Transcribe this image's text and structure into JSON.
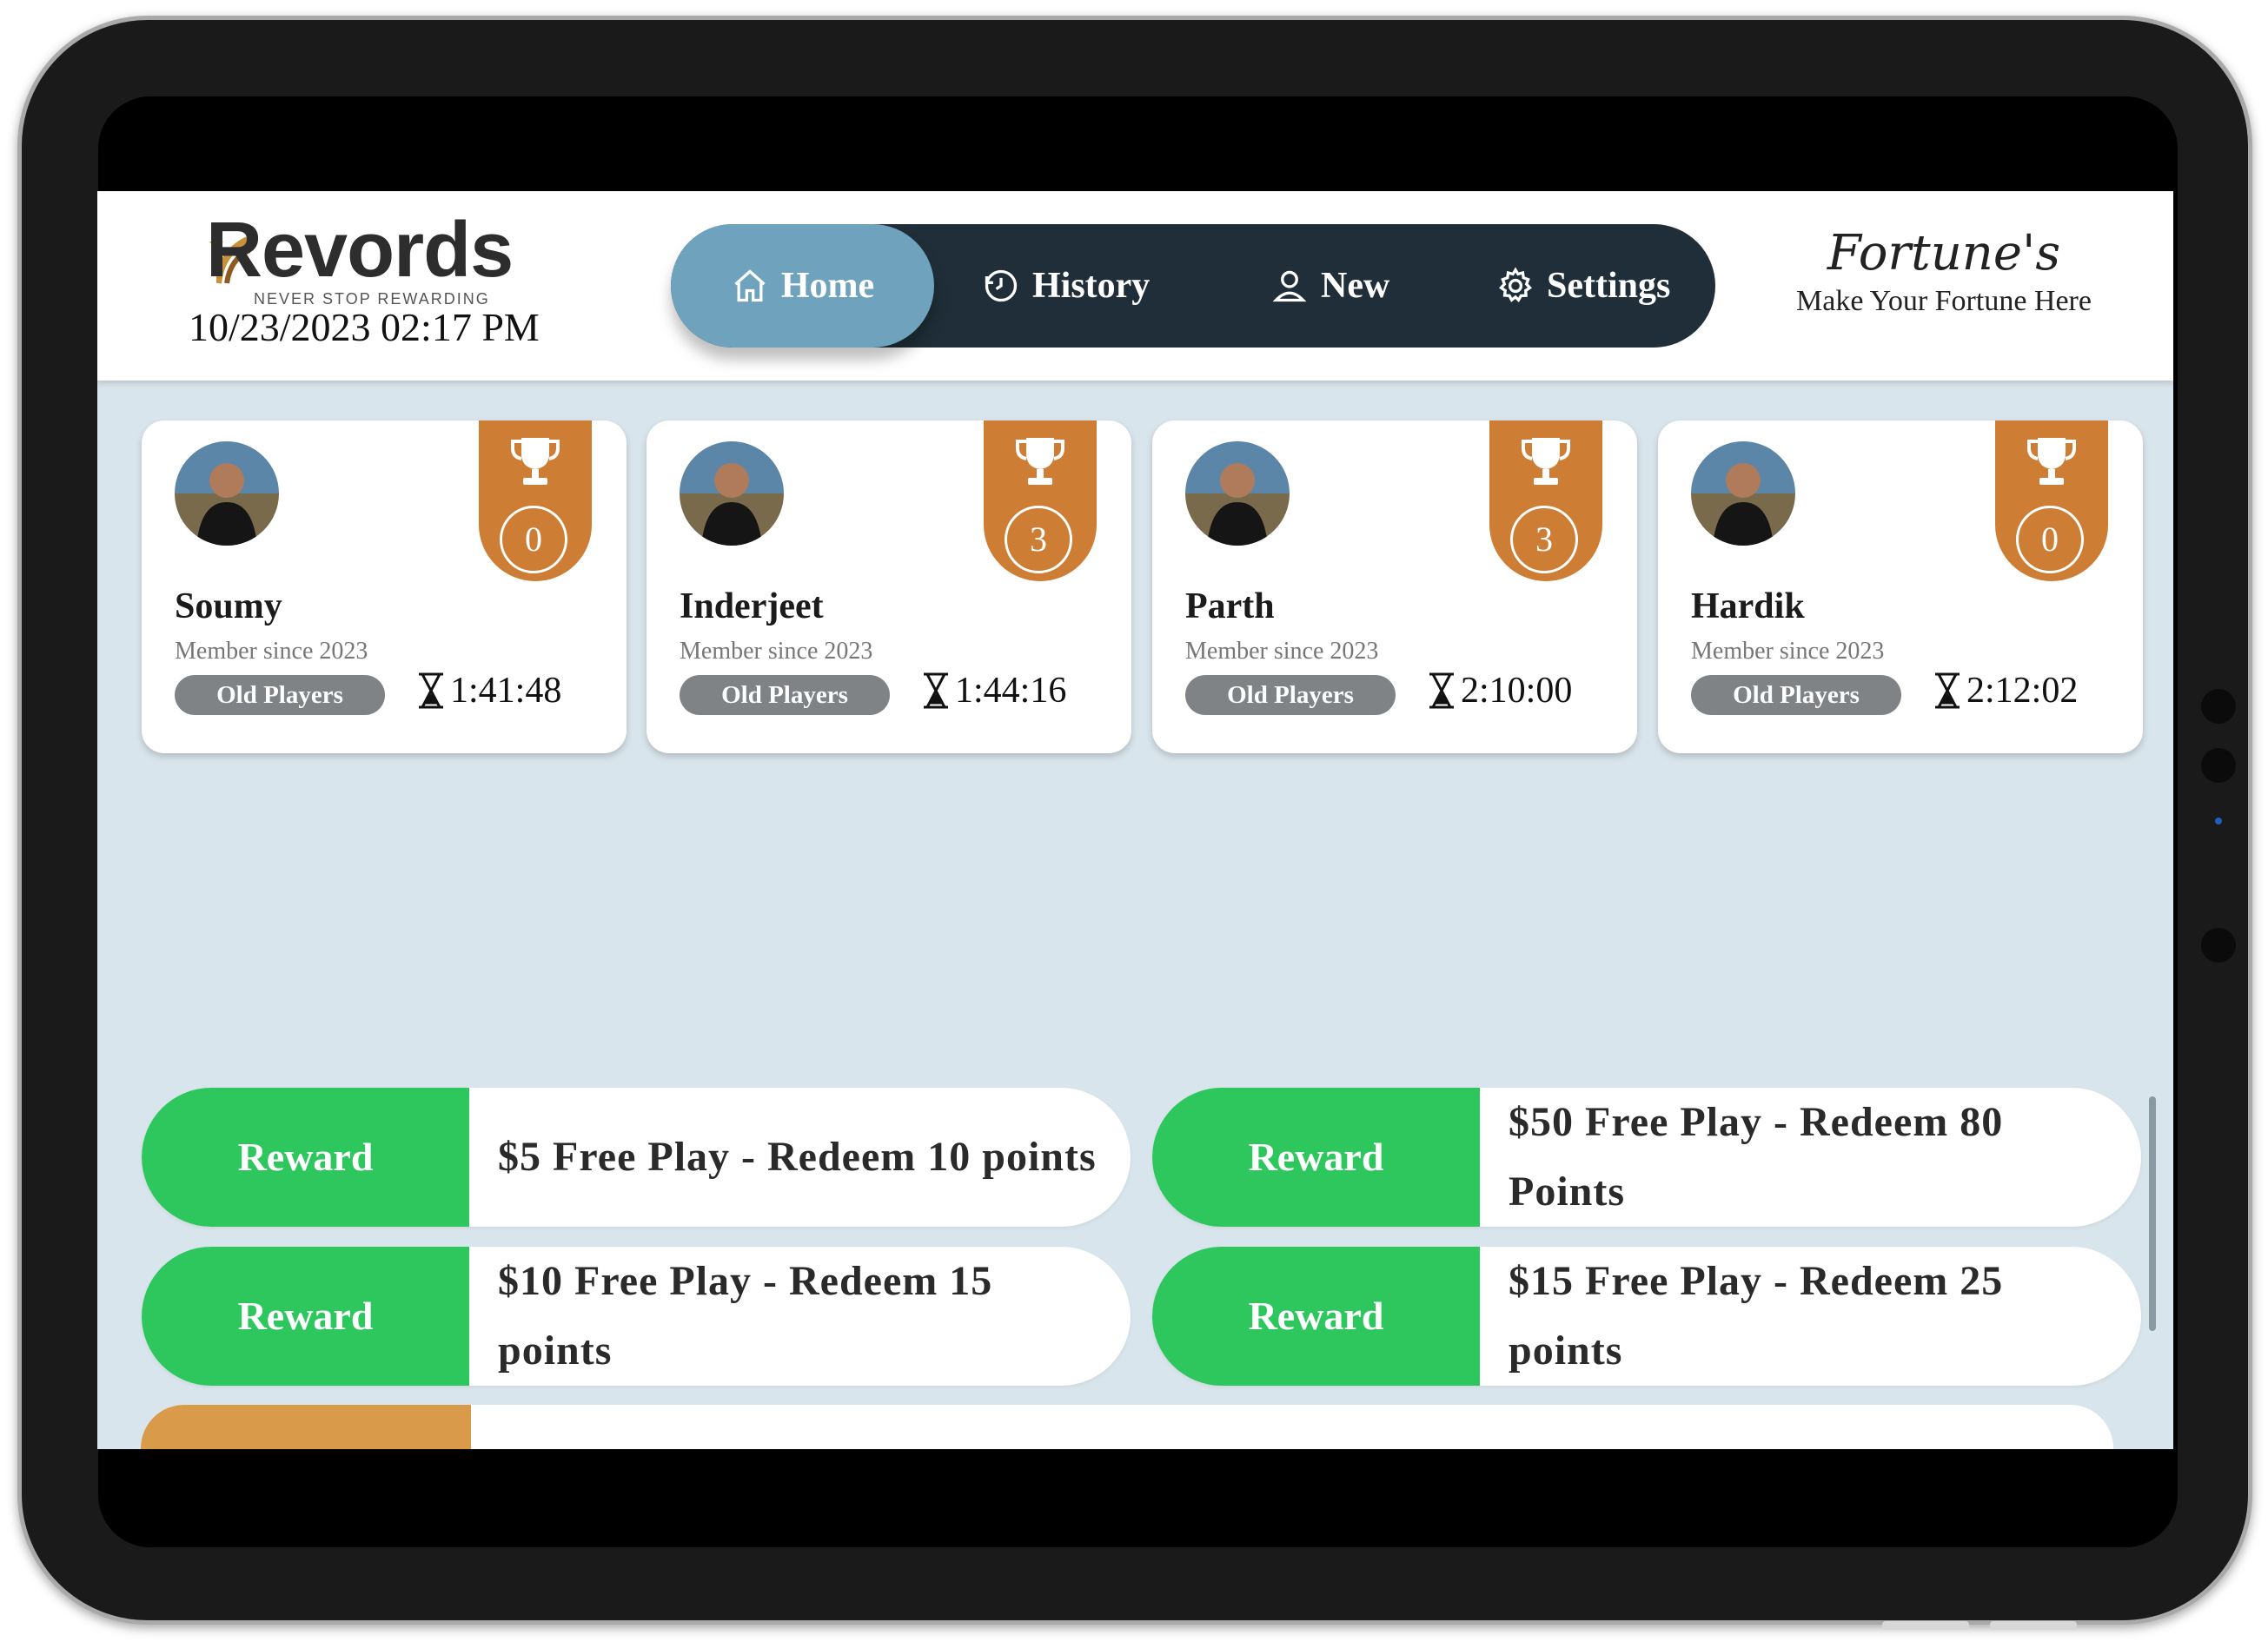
{
  "header": {
    "logo_text": "Revords",
    "logo_tagline": "NEVER STOP REWARDING",
    "datetime": "10/23/2023 02:17 PM",
    "brand_name": "Fortune's",
    "brand_tagline": "Make Your Fortune Here"
  },
  "nav": {
    "items": [
      {
        "label": "Home",
        "icon": "home-icon",
        "active": true
      },
      {
        "label": "History",
        "icon": "history-icon",
        "active": false
      },
      {
        "label": "New",
        "icon": "user-icon",
        "active": false
      },
      {
        "label": "Settings",
        "icon": "gear-icon",
        "active": false
      }
    ]
  },
  "players": [
    {
      "name": "Soumy",
      "member_since": "Member since 2023",
      "tag": "Old Players",
      "timer": "1:41:48",
      "trophy_count": "0"
    },
    {
      "name": "Inderjeet",
      "member_since": "Member since 2023",
      "tag": "Old Players",
      "timer": "1:44:16",
      "trophy_count": "3"
    },
    {
      "name": "Parth",
      "member_since": "Member since 2023",
      "tag": "Old Players",
      "timer": "2:10:00",
      "trophy_count": "3"
    },
    {
      "name": "Hardik",
      "member_since": "Member since 2023",
      "tag": "Old Players",
      "timer": "2:12:02",
      "trophy_count": "0"
    }
  ],
  "rewards": [
    {
      "button": "Reward",
      "text": "$5 Free Play - Redeem 10 points"
    },
    {
      "button": "Reward",
      "text": "$50 Free Play - Redeem 80 Points"
    },
    {
      "button": "Reward",
      "text": "$10 Free Play - Redeem 15 points"
    },
    {
      "button": "Reward",
      "text": "$15 Free Play - Redeem 25 points"
    }
  ],
  "colors": {
    "nav_bg": "#1f2e38",
    "nav_active": "#6fa3bd",
    "badge": "#cd7e34",
    "reward_green": "#2dc75e",
    "screen_bg": "#d9e5ec"
  }
}
